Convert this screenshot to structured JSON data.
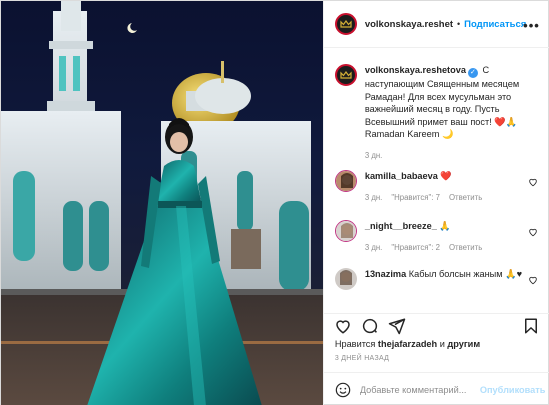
{
  "post": {
    "username": "volkonskaya.reshet",
    "follow_label": "Подписаться",
    "more_label": "•••",
    "dot": "•"
  },
  "caption": {
    "username": "volkonskaya.reshetova",
    "verified_mark": "✓",
    "text": " С наступающим Священным месяцем Рамадан! Для всех мусульман это важнейший месяц в году. Пусть Всевышний примет ваш пост! ❤️🙏 Ramadan Kareem 🌙",
    "age": "3 дн."
  },
  "comments": [
    {
      "username": "kamilla_babaeva",
      "text": " ❤️",
      "age": "3 дн.",
      "likes": "\"Нравится\": 7",
      "reply": "Ответить"
    },
    {
      "username": "_night__breeze_",
      "text": " 🙏",
      "age": "3 дн.",
      "likes": "\"Нравится\": 2",
      "reply": "Ответить"
    },
    {
      "username": "13nazima",
      "text": " Кабыл болсын жаным 🙏♥",
      "age": "",
      "likes": "",
      "reply": ""
    }
  ],
  "actions": {
    "icons": [
      "heart-icon",
      "comment-icon",
      "share-icon",
      "bookmark-icon"
    ]
  },
  "likes": {
    "prefix": "Нравится ",
    "user": "thejafarzadeh",
    "mid": " и ",
    "others": "другим"
  },
  "date": "3 ДНЕЙ НАЗАД",
  "add_comment": {
    "placeholder": "Добавьте комментарий...",
    "publish_label": "Опубликовать"
  },
  "colors": {
    "link_blue": "#0095f6",
    "verified_blue": "#3897f0",
    "publish_disabled": "#b2dffc",
    "avatar_ring": "#c8102e",
    "muted": "#8e8e8e"
  }
}
